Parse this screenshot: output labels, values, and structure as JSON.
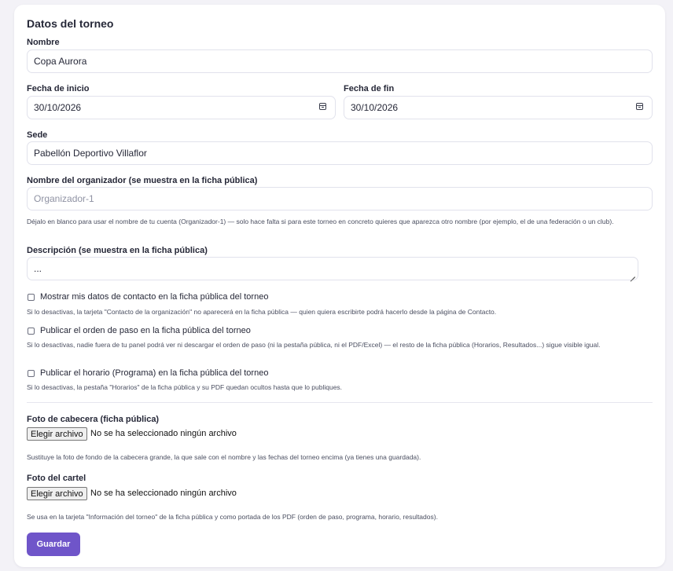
{
  "card": {
    "title": "Datos del torneo"
  },
  "nombre": {
    "label": "Nombre",
    "value": "Copa Aurora"
  },
  "fecha_inicio": {
    "label": "Fecha de inicio",
    "value": "30/10/2026"
  },
  "fecha_fin": {
    "label": "Fecha de fin",
    "value": "30/10/2026"
  },
  "sede": {
    "label": "Sede",
    "value": "Pabellón Deportivo Villaflor"
  },
  "organizador": {
    "label": "Nombre del organizador (se muestra en la ficha pública)",
    "placeholder": "Organizador-1",
    "help": "Déjalo en blanco para usar el nombre de tu cuenta (Organizador-1) — solo hace falta si para este torneo en concreto quieres que aparezca otro nombre (por ejemplo, el de una federación o un club)."
  },
  "descripcion": {
    "label": "Descripción (se muestra en la ficha pública)",
    "value": "..."
  },
  "checks": [
    {
      "label": "Mostrar mis datos de contacto en la ficha pública del torneo",
      "help": "Si lo desactivas, la tarjeta \"Contacto de la organización\" no aparecerá en la ficha pública — quien quiera escribirte podrá hacerlo desde la página de Contacto.",
      "checked": false
    },
    {
      "label": "Publicar el orden de paso en la ficha pública del torneo",
      "help": "Si lo desactivas, nadie fuera de tu panel podrá ver ni descargar el orden de paso (ni la pestaña pública, ni el PDF/Excel) — el resto de la ficha pública (Horarios, Resultados...) sigue visible igual.",
      "checked": false
    },
    {
      "label": "Publicar el horario (Programa) en la ficha pública del torneo",
      "help": "Si lo desactivas, la pestaña \"Horarios\" de la ficha pública y su PDF quedan ocultos hasta que lo publiques.",
      "checked": false
    }
  ],
  "foto_cabecera": {
    "label": "Foto de cabecera (ficha pública)",
    "button": "Elegir archivo",
    "status": "No se ha seleccionado ningún archivo",
    "help": "Sustituye la foto de fondo de la cabecera grande, la que sale con el nombre y las fechas del torneo encima (ya tienes una guardada)."
  },
  "foto_cartel": {
    "label": "Foto del cartel",
    "button": "Elegir archivo",
    "status": "No se ha seleccionado ningún archivo",
    "help": "Se usa en la tarjeta \"Información del torneo\" de la ficha pública y como portada de los PDF (orden de paso, programa, horario, resultados)."
  },
  "save_button": "Guardar",
  "colors": {
    "accent": "#6f55c9",
    "background": "#f3f2f7",
    "card": "#ffffff",
    "border": "#e1e2ec"
  },
  "icons": {
    "date": "calendar-icon",
    "textarea": "resize-handle-icon"
  }
}
